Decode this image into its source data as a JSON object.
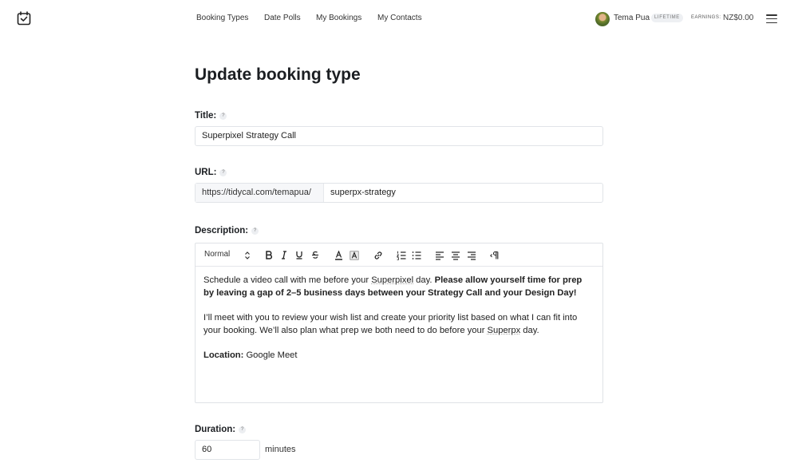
{
  "nav": {
    "items": [
      "Booking Types",
      "Date Polls",
      "My Bookings",
      "My Contacts"
    ]
  },
  "user": {
    "name": "Tema Pua",
    "plan": "LIFETIME",
    "earnings_label": "EARNINGS:",
    "earnings_value": "NZ$0.00"
  },
  "page": {
    "title": "Update booking type"
  },
  "form": {
    "title_label": "Title:",
    "title_value": "Superpixel Strategy Call",
    "url_label": "URL:",
    "url_prefix": "https://tidycal.com/temapua/",
    "url_slug": "superpx-strategy",
    "description_label": "Description:",
    "duration_label": "Duration:",
    "duration_value": "60",
    "duration_unit": "minutes",
    "help_glyph": "?"
  },
  "editor": {
    "format_select": "Normal",
    "p1_a": "Schedule a video call with me before your ",
    "p1_sq": "Superpixel",
    "p1_b": " day. ",
    "p1_bold": "Please allow yourself time for prep by leaving a gap of 2–5 business days between your Strategy Call and your Design Day!",
    "p2_a": "I’ll meet with you to review your wish list and create your priority list based on what I can fit into your booking. We’ll also plan what prep we both need to do before your ",
    "p2_sq": "Superpx",
    "p2_b": " day.",
    "p3_label": "Location:",
    "p3_value": " Google Meet"
  },
  "colors": {
    "text": "#1f2226",
    "border": "#e1e4e8",
    "prefix_bg": "#f6f7f9"
  }
}
